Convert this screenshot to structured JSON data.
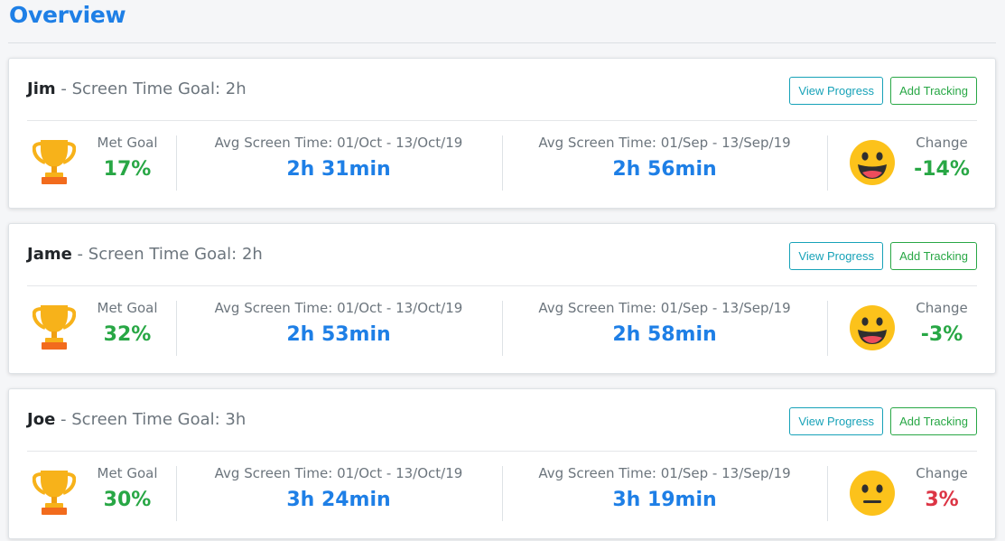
{
  "page": {
    "title": "Overview"
  },
  "cards": [
    {
      "name": "Jim",
      "separator": "-",
      "goal_text": "Screen Time Goal: 2h",
      "view_label": "View Progress",
      "add_label": "Add Tracking",
      "met_goal_label": "Met Goal",
      "met_goal_value": "17%",
      "current_label": "Avg Screen Time: 01/Oct - 13/Oct/19",
      "current_value": "2h 31min",
      "previous_label": "Avg Screen Time: 01/Sep - 13/Sep/19",
      "previous_value": "2h 56min",
      "change_label": "Change",
      "change_value": "-14%",
      "change_status": "good",
      "emoji_icon": "grinning-face-icon"
    },
    {
      "name": "Jame",
      "separator": "-",
      "goal_text": "Screen Time Goal: 2h",
      "view_label": "View Progress",
      "add_label": "Add Tracking",
      "met_goal_label": "Met Goal",
      "met_goal_value": "32%",
      "current_label": "Avg Screen Time: 01/Oct - 13/Oct/19",
      "current_value": "2h 53min",
      "previous_label": "Avg Screen Time: 01/Sep - 13/Sep/19",
      "previous_value": "2h 58min",
      "change_label": "Change",
      "change_value": "-3%",
      "change_status": "good",
      "emoji_icon": "grinning-face-icon"
    },
    {
      "name": "Joe",
      "separator": "-",
      "goal_text": "Screen Time Goal: 3h",
      "view_label": "View Progress",
      "add_label": "Add Tracking",
      "met_goal_label": "Met Goal",
      "met_goal_value": "30%",
      "current_label": "Avg Screen Time: 01/Oct - 13/Oct/19",
      "current_value": "3h 24min",
      "previous_label": "Avg Screen Time: 01/Sep - 13/Sep/19",
      "previous_value": "3h 19min",
      "change_label": "Change",
      "change_value": "3%",
      "change_status": "bad",
      "emoji_icon": "neutral-face-icon"
    }
  ],
  "colors": {
    "accent": "#1e7fe6",
    "success": "#28a745",
    "danger": "#dc3545",
    "info": "#17a2b8",
    "trophy": "#f7b21a",
    "emoji": "#fcc21b"
  }
}
